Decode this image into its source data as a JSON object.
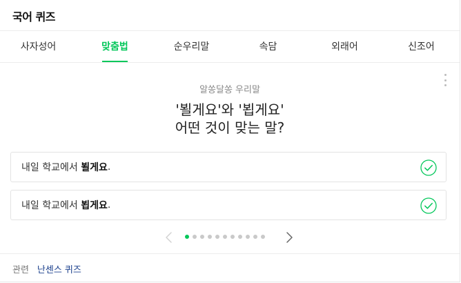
{
  "header": {
    "title": "국어 퀴즈"
  },
  "tabs": [
    {
      "label": "사자성어",
      "active": false
    },
    {
      "label": "맞춤법",
      "active": true
    },
    {
      "label": "순우리말",
      "active": false
    },
    {
      "label": "속담",
      "active": false
    },
    {
      "label": "외래어",
      "active": false
    },
    {
      "label": "신조어",
      "active": false
    }
  ],
  "quiz": {
    "category": "알쏭달쏭 우리말",
    "question_line1": "'뵐게요'와 '뵙게요'",
    "question_line2": "어떤 것이 맞는 말?",
    "answers": [
      {
        "prefix": "내일 학교에서 ",
        "emphasis": "뵐게요",
        "suffix": "."
      },
      {
        "prefix": "내일 학교에서 ",
        "emphasis": "뵙게요",
        "suffix": "."
      }
    ],
    "check_icon": "check-circle-icon",
    "accent_color": "#03c75a"
  },
  "pagination": {
    "total_dots": 11,
    "active_index": 0,
    "prev_icon": "chevron-left-icon",
    "next_icon": "chevron-right-icon"
  },
  "footer": {
    "label": "관련",
    "link": "난센스 퀴즈"
  }
}
